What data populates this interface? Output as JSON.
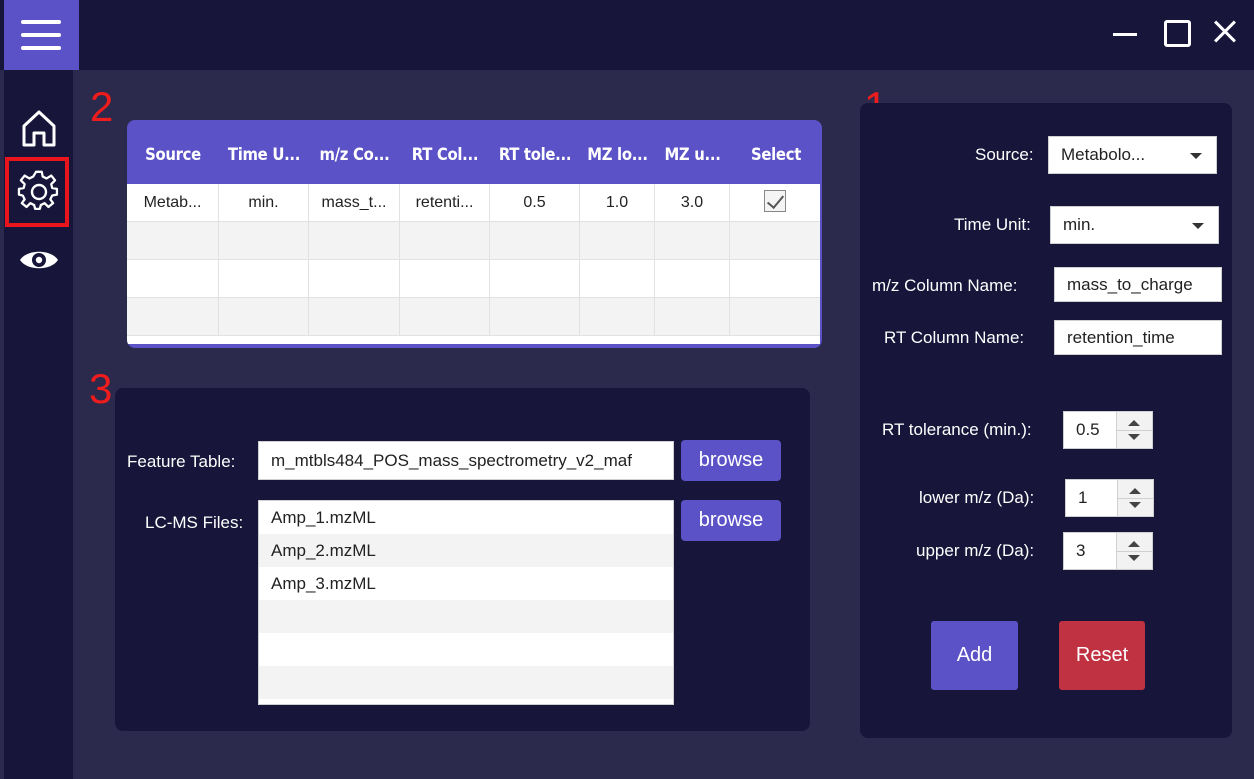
{
  "window": {
    "controls": [
      "minimize-icon",
      "maximize-icon",
      "close-icon"
    ]
  },
  "sidebar": {
    "items": [
      {
        "icon": "home-icon"
      },
      {
        "icon": "gear-icon",
        "selected": true
      },
      {
        "icon": "eye-icon"
      }
    ]
  },
  "annotations": [
    "1",
    "2",
    "3"
  ],
  "table": {
    "columns": [
      "Source",
      "Time U...",
      "m/z Co...",
      "RT Col...",
      "RT tole...",
      "MZ lo...",
      "MZ u...",
      "Select"
    ],
    "rows": [
      [
        "Metab...",
        "min.",
        "mass_t...",
        "retenti...",
        "0.5",
        "1.0",
        "3.0",
        true
      ]
    ]
  },
  "files": {
    "feature_table_label": "Feature Table:",
    "feature_table_value": "m_mtbls484_POS_mass_spectrometry_v2_maf",
    "browse_label": "browse",
    "lcms_label": "LC-MS Files:",
    "lcms_files": [
      "Amp_1.mzML",
      "Amp_2.mzML",
      "Amp_3.mzML"
    ]
  },
  "form": {
    "source_label": "Source:",
    "source_value": "Metabolo...",
    "time_unit_label": "Time Unit:",
    "time_unit_value": "min.",
    "mz_col_label": "m/z Column Name:",
    "mz_col_value": "mass_to_charge",
    "rt_col_label": "RT Column Name:",
    "rt_col_value": "retention_time",
    "rt_tol_label": "RT tolerance (min.):",
    "rt_tol_value": "0.5",
    "lower_mz_label": "lower m/z (Da):",
    "lower_mz_value": "1",
    "upper_mz_label": "upper m/z (Da):",
    "upper_mz_value": "3",
    "add_label": "Add",
    "reset_label": "Reset"
  },
  "colors": {
    "accent": "#5b52c7",
    "panel": "#17163a",
    "background": "#2b2a4c",
    "danger": "#c03141",
    "annotation": "#ee1c1c"
  }
}
